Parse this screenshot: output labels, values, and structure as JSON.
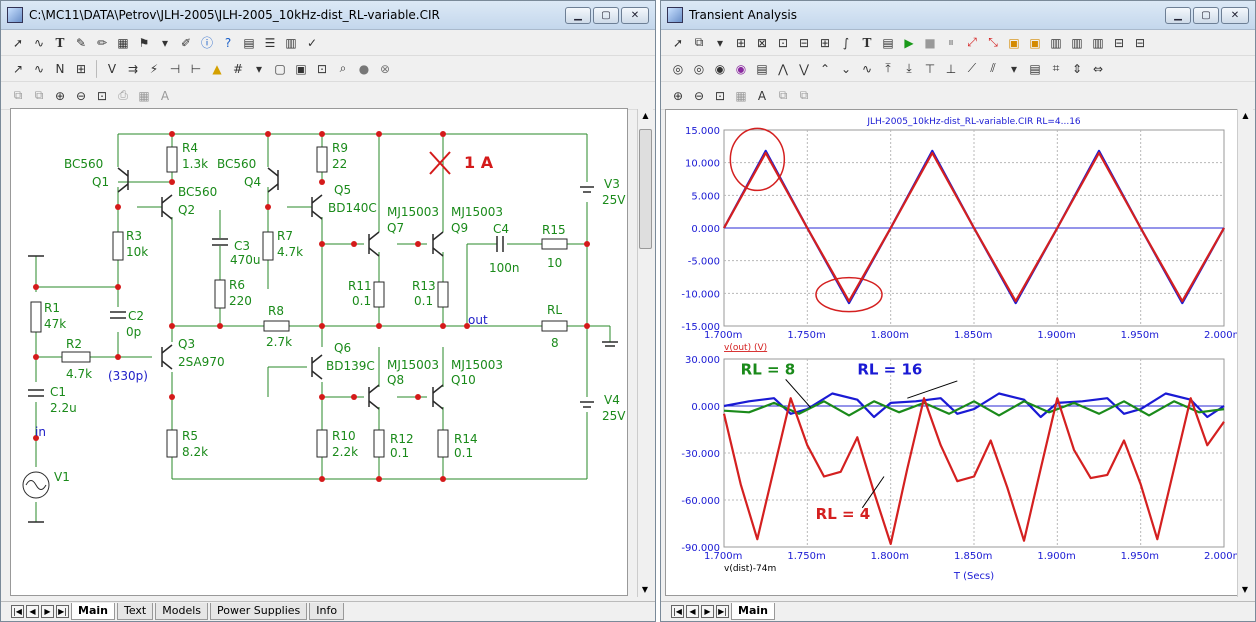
{
  "schematic_window": {
    "title": "C:\\MC11\\DATA\\Petrov\\JLH-2005\\JLH-2005_10kHz-dist_RL-variable.CIR",
    "tabs": [
      "Main",
      "Text",
      "Models",
      "Power Supplies",
      "Info"
    ],
    "active_tab": "Main",
    "labels": {
      "q1_type": "BC560",
      "q1": "Q1",
      "q2_type": "BC560",
      "q2": "Q2",
      "q4_type": "BC560",
      "q4": "Q4",
      "q5": "Q5",
      "q5_type": "BD140C",
      "q7_type": "MJ15003",
      "q7": "Q7",
      "q9_type": "MJ15003",
      "q9": "Q9",
      "q3": "Q3",
      "q3_type": "2SA970",
      "q6": "Q6",
      "q6_type": "BD139C",
      "q8_type": "MJ15003",
      "q8": "Q8",
      "q10_type": "MJ15003",
      "q10": "Q10",
      "r4": "R4",
      "r4_val": "1.3k",
      "r9": "R9",
      "r9_val": "22",
      "r3": "R3",
      "r3_val": "10k",
      "r7": "R7",
      "r7_val": "4.7k",
      "c3": "C3",
      "c3_val": "470u",
      "r6": "R6",
      "r6_val": "220",
      "r8": "R8",
      "r8_val": "2.7k",
      "r11": "R11",
      "r11_val": "0.1",
      "r13": "R13",
      "r13_val": "0.1",
      "c4": "C4",
      "c4_val": "100n",
      "r15": "R15",
      "r15_val": "10",
      "rl": "RL",
      "rl_val": "8",
      "out": "out",
      "r1": "R1",
      "r1_val": "47k",
      "c2": "C2",
      "c2_val": "0p",
      "r2": "R2",
      "r2_val": "4.7k",
      "c2_note": "(330p)",
      "c1": "C1",
      "c1_val": "2.2u",
      "in": "in",
      "v1": "V1",
      "r5": "R5",
      "r5_val": "8.2k",
      "r10": "R10",
      "r10_val": "2.2k",
      "r12": "R12",
      "r12_val": "0.1",
      "r14": "R14",
      "r14_val": "0.1",
      "v3": "V3",
      "v3_val": "25V",
      "v4": "V4",
      "v4_val": "25V",
      "current_marker": "1 A"
    }
  },
  "analysis_window": {
    "title": "Transient Analysis",
    "tabs": [
      "Main"
    ],
    "active_tab": "Main"
  },
  "chart_data": [
    {
      "type": "line",
      "title": "JLH-2005_10kHz-dist_RL-variable.CIR RL=4...16",
      "xlabel": "",
      "ylabel": "v(out) (V)",
      "xlim": [
        1.7,
        2.0
      ],
      "x_unit": "m",
      "x_ticks": [
        "1.700m",
        "1.750m",
        "1.800m",
        "1.850m",
        "1.900m",
        "1.950m",
        "2.000m"
      ],
      "ylim": [
        -15,
        15
      ],
      "y_ticks": [
        "15.000",
        "10.000",
        "5.000",
        "0.000",
        "-5.000",
        "-10.000",
        "-15.000"
      ],
      "grid": true,
      "series": [
        {
          "name": "",
          "color": "#1a1ad4",
          "x": [
            1.7,
            1.725,
            1.75,
            1.775,
            1.8,
            1.825,
            1.85,
            1.875,
            1.9,
            1.925,
            1.95,
            1.975,
            2.0
          ],
          "y": [
            0,
            11.8,
            0,
            -11.5,
            0,
            11.8,
            0,
            -11.5,
            0,
            11.8,
            0,
            -11.5,
            0
          ]
        },
        {
          "name": "",
          "color": "#d42020",
          "x": [
            1.7,
            1.725,
            1.75,
            1.775,
            1.8,
            1.825,
            1.85,
            1.875,
            1.9,
            1.925,
            1.95,
            1.975,
            2.0
          ],
          "y": [
            0,
            11.5,
            0,
            -11.2,
            0,
            11.5,
            0,
            -11.2,
            0,
            11.5,
            0,
            -11.2,
            0
          ]
        }
      ]
    },
    {
      "type": "line",
      "title": "",
      "xlabel": "T (Secs)",
      "ylabel": "v(dist)-74m",
      "xlim": [
        1.7,
        2.0
      ],
      "x_unit": "m",
      "x_ticks": [
        "1.700m",
        "1.750m",
        "1.800m",
        "1.850m",
        "1.900m",
        "1.950m",
        "2.000m"
      ],
      "ylim": [
        -90,
        30
      ],
      "y_ticks": [
        "30.000",
        "0.000",
        "-30.000",
        "-60.000",
        "-90.000"
      ],
      "grid": true,
      "annotations": [
        "RL = 8",
        "RL = 16",
        "RL = 4"
      ],
      "series": [
        {
          "name": "RL = 16",
          "color": "#1a1ad4",
          "x": [
            1.7,
            1.715,
            1.73,
            1.74,
            1.75,
            1.765,
            1.78,
            1.79,
            1.8,
            1.815,
            1.83,
            1.84,
            1.85,
            1.865,
            1.88,
            1.89,
            1.9,
            1.915,
            1.93,
            1.94,
            1.95,
            1.965,
            1.98,
            1.99,
            2.0
          ],
          "y": [
            0,
            3,
            5,
            -5,
            -2,
            8,
            4,
            -7,
            2,
            3,
            5,
            -5,
            -2,
            8,
            4,
            -7,
            2,
            3,
            5,
            -5,
            -2,
            8,
            4,
            -7,
            0
          ]
        },
        {
          "name": "RL = 8",
          "color": "#1a8a1a",
          "x": [
            1.7,
            1.715,
            1.73,
            1.745,
            1.76,
            1.775,
            1.79,
            1.805,
            1.82,
            1.835,
            1.85,
            1.865,
            1.88,
            1.895,
            1.91,
            1.925,
            1.94,
            1.955,
            1.97,
            1.985,
            2.0
          ],
          "y": [
            -3,
            -4,
            2,
            -5,
            3,
            -6,
            3,
            -4,
            2,
            -5,
            3,
            -6,
            3,
            -4,
            2,
            -5,
            3,
            -6,
            3,
            -4,
            -2
          ]
        },
        {
          "name": "RL = 4",
          "color": "#d42020",
          "x": [
            1.7,
            1.71,
            1.72,
            1.73,
            1.74,
            1.75,
            1.76,
            1.77,
            1.78,
            1.79,
            1.8,
            1.81,
            1.82,
            1.83,
            1.84,
            1.85,
            1.86,
            1.87,
            1.88,
            1.89,
            1.9,
            1.91,
            1.92,
            1.93,
            1.94,
            1.95,
            1.96,
            1.97,
            1.98,
            1.99,
            2.0
          ],
          "y": [
            -5,
            -50,
            -85,
            -40,
            5,
            -25,
            -45,
            -42,
            -20,
            -55,
            -88,
            -40,
            5,
            -25,
            -48,
            -45,
            -22,
            -52,
            -86,
            -40,
            5,
            -28,
            -46,
            -44,
            -22,
            -50,
            -85,
            -40,
            5,
            -25,
            -10
          ]
        }
      ]
    }
  ]
}
